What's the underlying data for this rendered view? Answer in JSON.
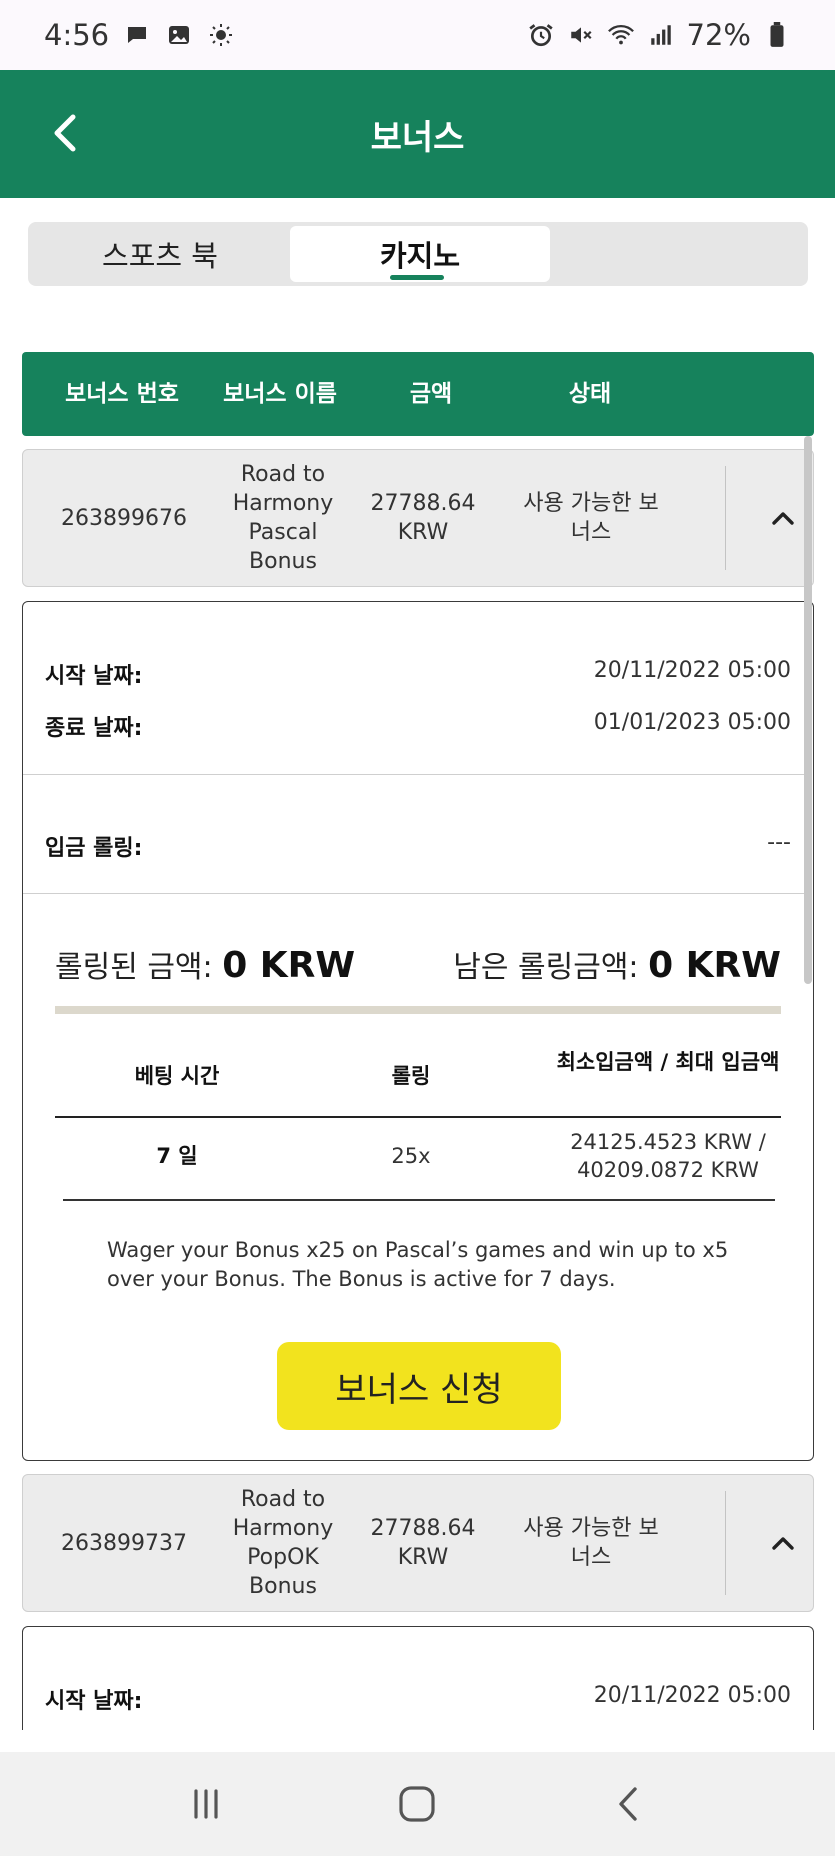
{
  "status_bar": {
    "time": "4:56",
    "battery": "72%",
    "icons_left": [
      "chat-icon",
      "image-icon",
      "sun-icon"
    ],
    "icons_right": [
      "alarm-icon",
      "mute-icon",
      "wifi-icon",
      "signal-icon",
      "battery-icon"
    ]
  },
  "header": {
    "title": "보너스",
    "back_icon": "chevron-left-icon",
    "color": "#16825c"
  },
  "tabs": [
    {
      "label": "스포츠 북",
      "selected": false
    },
    {
      "label": "카지노",
      "selected": true
    }
  ],
  "table_header": {
    "col1": "보너스 번호",
    "col2": "보너스 이름",
    "col3": "금액",
    "col4": "상태"
  },
  "bonuses": [
    {
      "id": "263899676",
      "name": "Road to Harmony Pascal Bonus",
      "amount": "27788.64 KRW",
      "status": "사용 가능한 보너스",
      "expanded": true,
      "start_label": "시작 날짜:",
      "start_value": "20/11/2022 05:00",
      "end_label": "종료 날짜:",
      "end_value": "01/01/2023 05:00",
      "deposit_roll_label": "입금 롤링:",
      "deposit_roll_value": "---",
      "rolled_label": "롤링된 금액:",
      "rolled_value": "0 KRW",
      "remaining_label": "남은 롤링금액:",
      "remaining_value": "0 KRW",
      "progress_fraction": 0,
      "inner_headers": [
        "베팅 시간",
        "롤링",
        "최소입금액 / 최대 입금액"
      ],
      "inner_row": [
        "7 일",
        "25x",
        "24125.4523 KRW / 40209.0872 KRW"
      ],
      "description": "Wager your Bonus x25 on Pascal’s games and win up to x5 over your Bonus. The Bonus is active for 7 days.",
      "apply_label": "보너스 신청"
    },
    {
      "id": "263899737",
      "name": "Road to Harmony PopOK Bonus",
      "amount": "27788.64 KRW",
      "status": "사용 가능한 보너스",
      "expanded": true,
      "start_label": "시작 날짜:",
      "start_value": "20/11/2022 05:00"
    }
  ],
  "accent_yellow": "#f2e31e",
  "nav": [
    "recents-icon",
    "home-icon",
    "back-icon"
  ]
}
